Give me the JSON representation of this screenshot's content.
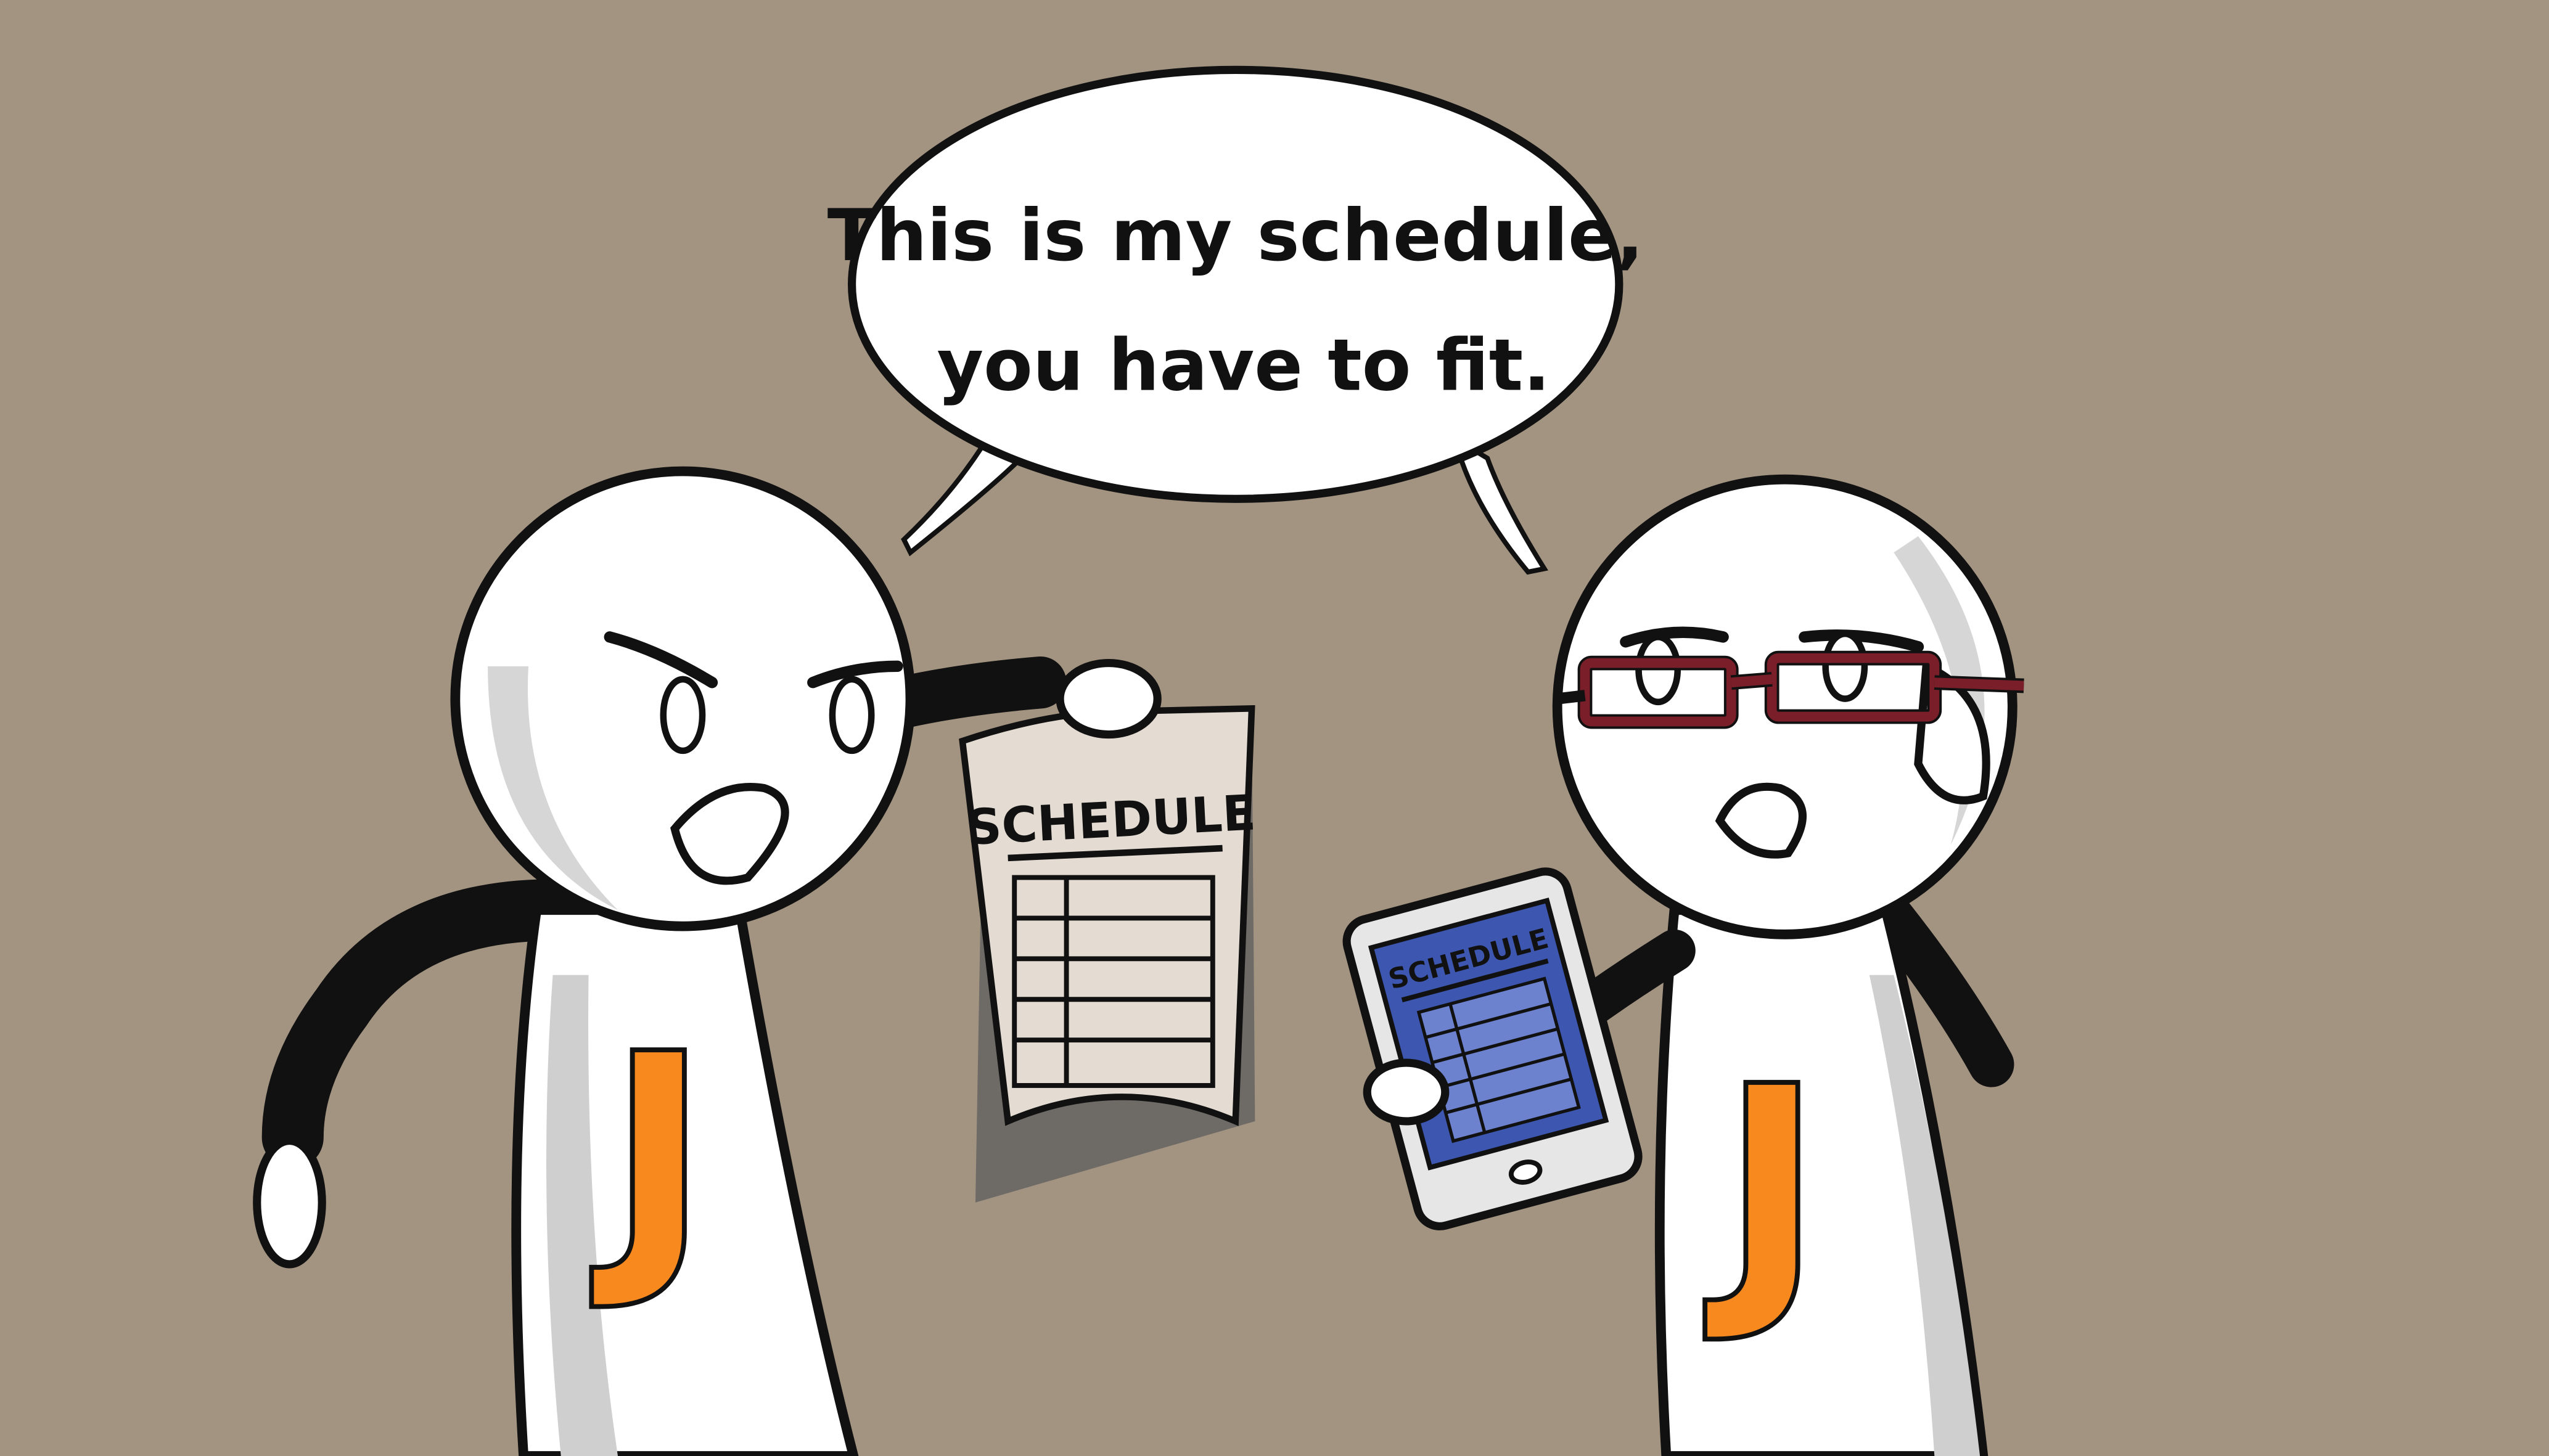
{
  "scene": {
    "background_color": "#a39482",
    "speech_bubble": {
      "line1": "This is my schedule,",
      "line2": "you have to fit."
    },
    "paper_schedule": {
      "title": "SCHEDULE"
    },
    "tablet_schedule": {
      "title": "SCHEDULE"
    },
    "left_character": {
      "shirt_letter": "J",
      "letter_color": "#f7891f"
    },
    "right_character": {
      "shirt_letter": "J",
      "letter_color": "#f7891f",
      "glasses_color": "#7a1f2a"
    }
  }
}
